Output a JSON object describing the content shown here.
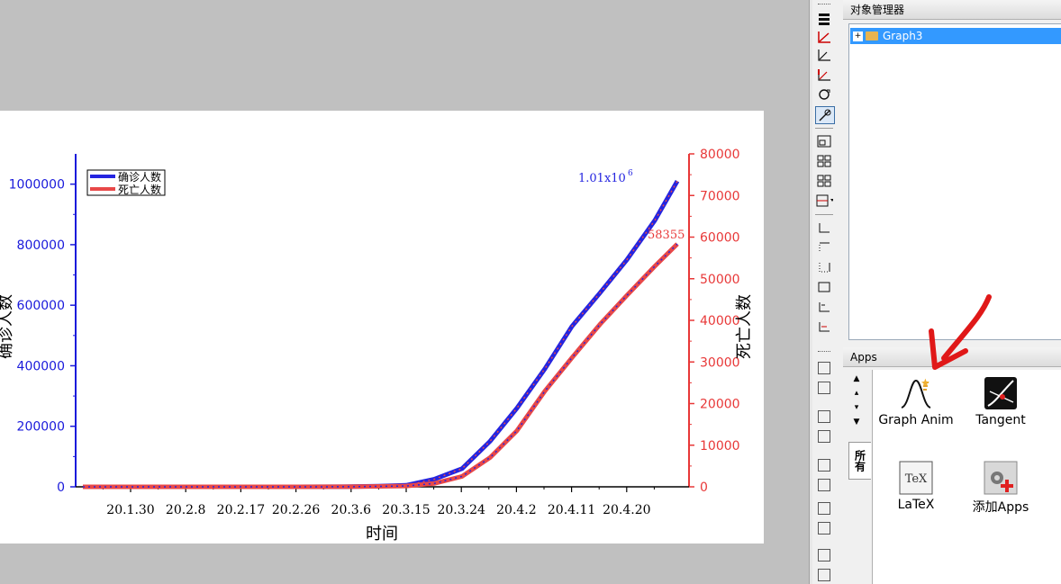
{
  "graph": {
    "legend": {
      "series1": "确诊人数",
      "series2": "死亡人数"
    },
    "annotations": {
      "max_confirmed": "1.01x10",
      "max_confirmed_exp": "6",
      "max_deaths": "58355"
    },
    "xlabel": "时间",
    "ylabel_left": "确诊人数",
    "ylabel_right": "死亡人数",
    "colors": {
      "left_axis": "#1a1adb",
      "right_axis": "#e83838",
      "confirmed": "#2424e0",
      "deaths": "#e84848"
    }
  },
  "chart_data": {
    "type": "line",
    "x_tick_labels": [
      "20.1.30",
      "20.2.8",
      "20.2.17",
      "20.2.26",
      "20.3.6",
      "20.3.15",
      "20.3.24",
      "20.4.2",
      "20.4.11",
      "20.4.20"
    ],
    "y_left_ticks": [
      "0",
      "200000",
      "400000",
      "600000",
      "800000",
      "1000000"
    ],
    "y_right_ticks": [
      "0",
      "10000",
      "20000",
      "30000",
      "40000",
      "50000",
      "60000",
      "70000",
      "80000"
    ],
    "y_left_range": [
      0,
      1100000
    ],
    "y_right_range": [
      0,
      80000
    ],
    "x": [
      "20.1.22",
      "20.1.30",
      "20.2.8",
      "20.2.17",
      "20.2.26",
      "20.3.6",
      "20.3.10",
      "20.3.15",
      "20.3.19",
      "20.3.24",
      "20.3.29",
      "20.4.2",
      "20.4.6",
      "20.4.11",
      "20.4.15",
      "20.4.20",
      "20.4.24",
      "20.4.28"
    ],
    "series": [
      {
        "name": "确诊人数",
        "axis": "left",
        "values": [
          0,
          0,
          0,
          0,
          0,
          500,
          2000,
          5000,
          25000,
          60000,
          150000,
          260000,
          390000,
          530000,
          640000,
          750000,
          880000,
          1010000
        ]
      },
      {
        "name": "死亡人数",
        "axis": "right",
        "values": [
          0,
          0,
          0,
          0,
          0,
          30,
          100,
          200,
          800,
          2500,
          7000,
          13500,
          23000,
          31000,
          39000,
          46000,
          53000,
          58355
        ]
      }
    ]
  },
  "toolbar": {
    "buttons": [
      "stack-icon",
      "rescale-icon",
      "axis-icon",
      "axis-red-icon",
      "rotate-icon",
      "zoom-icon",
      "layer-icon",
      "grid-icon",
      "grid2-icon",
      "merge-icon",
      "border-bottom-icon",
      "border-top-icon",
      "border-left-icon",
      "border-right-icon",
      "border-box-icon",
      "border-corner-icon"
    ]
  },
  "object_manager": {
    "title": "对象管理器",
    "item": "Graph3"
  },
  "apps_panel": {
    "title": "Apps",
    "tab": "所有",
    "items": [
      {
        "label": "Graph Anim"
      },
      {
        "label": "Tangent"
      },
      {
        "label": "LaTeX"
      },
      {
        "label": "添加Apps"
      }
    ]
  }
}
